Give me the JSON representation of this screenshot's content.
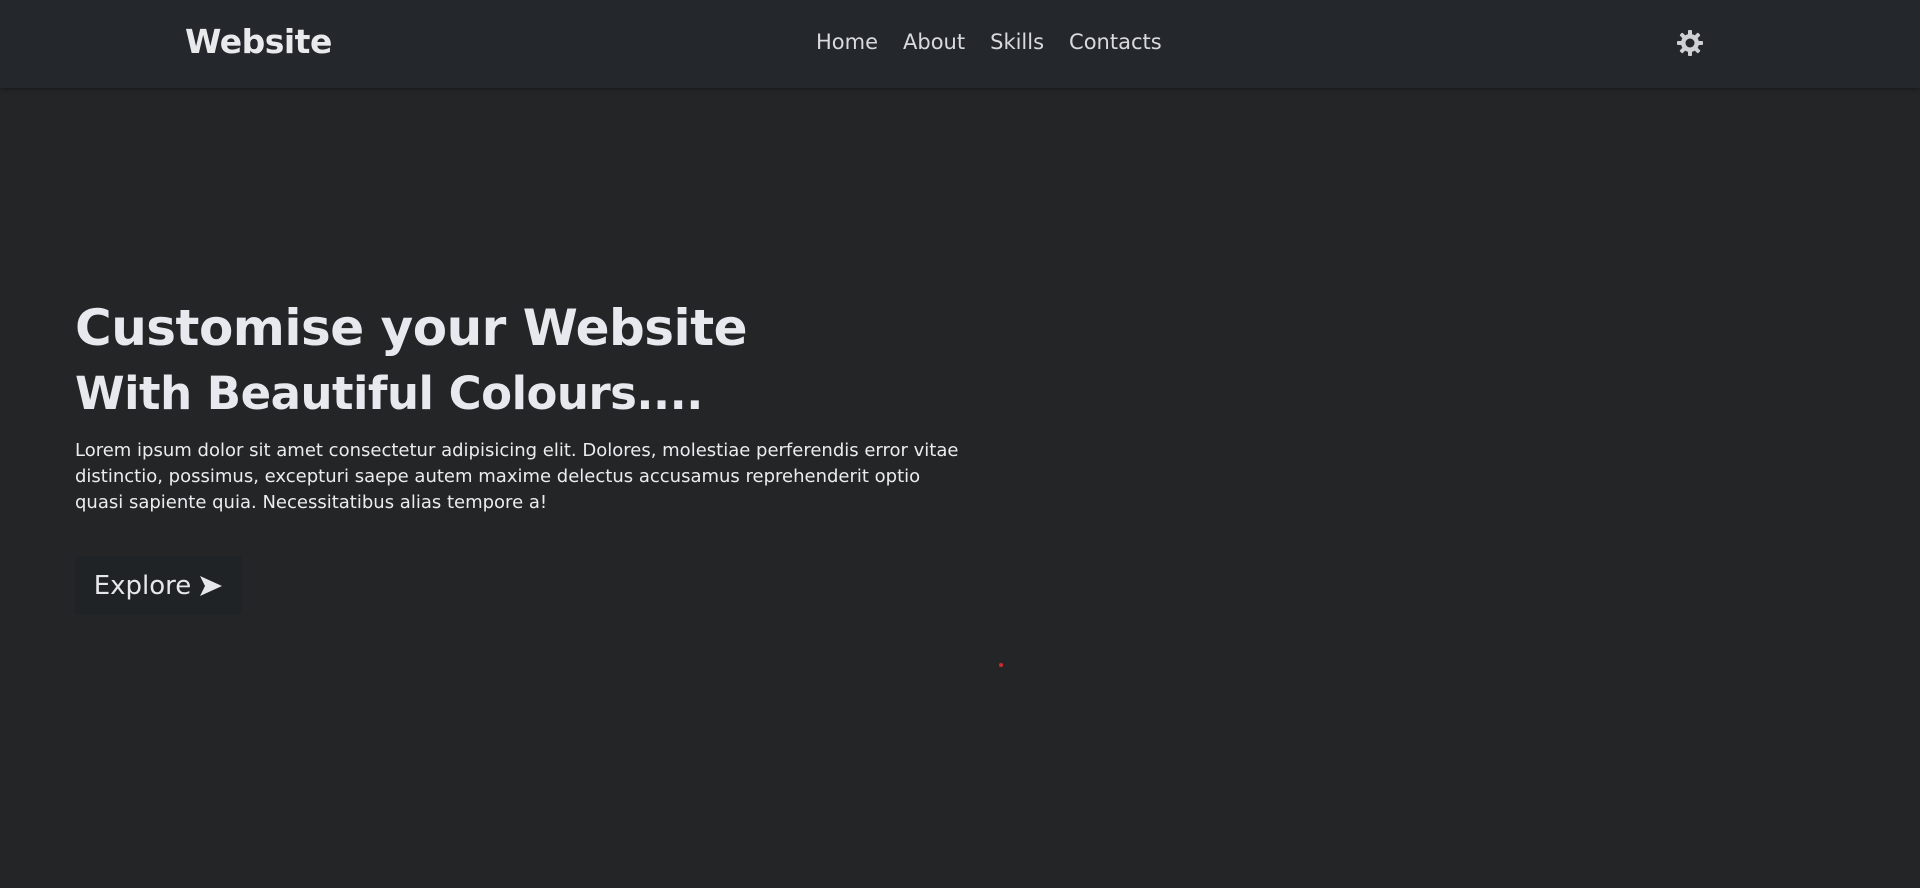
{
  "navbar": {
    "brand": "Website",
    "links": [
      "Home",
      "About",
      "Skills",
      "Contacts"
    ],
    "theme_icon": "gear-icon"
  },
  "hero": {
    "title": "Customise your Website",
    "subtitle": "With Beautiful Colours....",
    "description": "Lorem ipsum dolor sit amet consectetur adipisicing elit. Dolores, molestiae perferendis error vitae distinctio, possimus, excepturi saepe autem maxime delectus accusamus reprehenderit optio quasi sapiente quia. Necessitatibus alias tempore a!",
    "button_label": "Explore",
    "button_icon": "arrow-right-icon"
  },
  "colors": {
    "background": "#242527",
    "navbar": "#24282c",
    "button": "#1f2326",
    "text": "#e8e9ee",
    "accent_dot": "#d2282a"
  }
}
